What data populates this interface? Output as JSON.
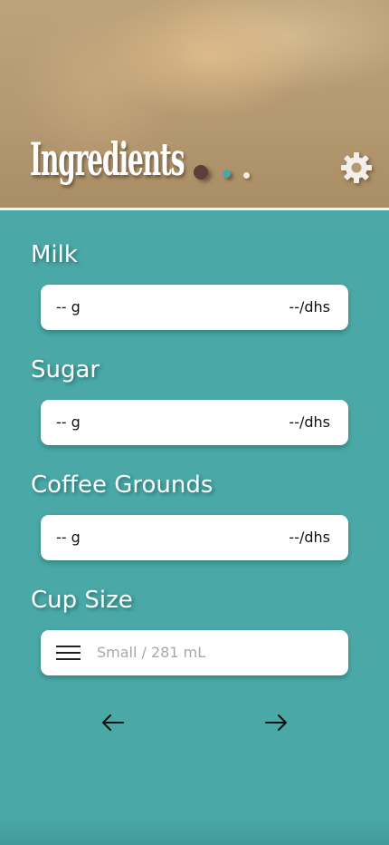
{
  "header": {
    "title": "Ingredients",
    "settings_icon": "gear-icon",
    "page_indicator": {
      "total": 3,
      "active": 1,
      "colors": [
        "#5a4038",
        "#4aa9a7",
        "#f3ece2"
      ]
    }
  },
  "ingredients": [
    {
      "label": "Milk",
      "quantity": "-- g",
      "price": "--/dhs"
    },
    {
      "label": "Sugar",
      "quantity": "-- g",
      "price": "--/dhs"
    },
    {
      "label": "Coffee Grounds",
      "quantity": "-- g",
      "price": "--/dhs"
    }
  ],
  "cup_size": {
    "label": "Cup Size",
    "menu_icon": "hamburger-menu-icon",
    "placeholder": "Small / 281 mL"
  },
  "navigation": {
    "back_icon": "arrow-left-icon",
    "next_icon": "arrow-right-icon"
  },
  "colors": {
    "background": "#4aa9a7",
    "header": "#b49870",
    "field": "#ffffff",
    "text_light": "#ffffff"
  }
}
